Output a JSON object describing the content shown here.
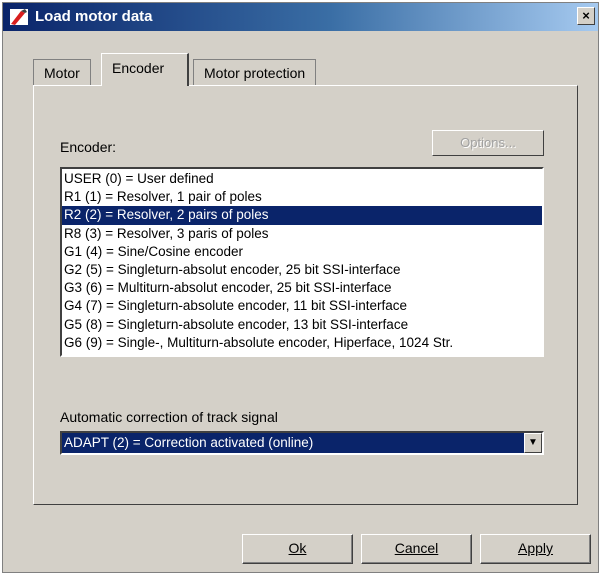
{
  "window": {
    "title": "Load motor data",
    "close_label": "×",
    "icon": "app-icon"
  },
  "tabs": [
    {
      "label": "Motor",
      "active": false
    },
    {
      "label": "Encoder",
      "active": true
    },
    {
      "label": "Motor protection",
      "active": false
    }
  ],
  "encoder": {
    "label": "Encoder:",
    "options_button": "Options...",
    "options_enabled": false,
    "selected_index": 2,
    "items": [
      "USER (0) = User defined",
      "R1 (1) = Resolver, 1 pair of poles",
      "R2 (2) = Resolver, 2 pairs of poles",
      "R8 (3) = Resolver, 3 paris of poles",
      "G1 (4) = Sine/Cosine encoder",
      "G2 (5) = Singleturn-absolut encoder, 25 bit SSI-interface",
      "G3 (6) = Multiturn-absolut encoder, 25 bit SSI-interface",
      "G4 (7) = Singleturn-absolute encoder, 11 bit SSI-interface",
      "G5 (8) = Singleturn-absolute encoder, 13 bit SSI-interface",
      "G6 (9) = Single-, Multiturn-absolute encoder, Hiperface, 1024 Str."
    ]
  },
  "track_signal": {
    "label": "Automatic correction of track signal",
    "value": "ADAPT (2) = Correction activated (online)"
  },
  "buttons": {
    "ok": "Ok",
    "cancel": "Cancel",
    "apply": "Apply"
  },
  "colors": {
    "face": "#d4d0c8",
    "selection": "#0a246a",
    "title_start": "#0a246a",
    "title_end": "#a6caf0"
  }
}
